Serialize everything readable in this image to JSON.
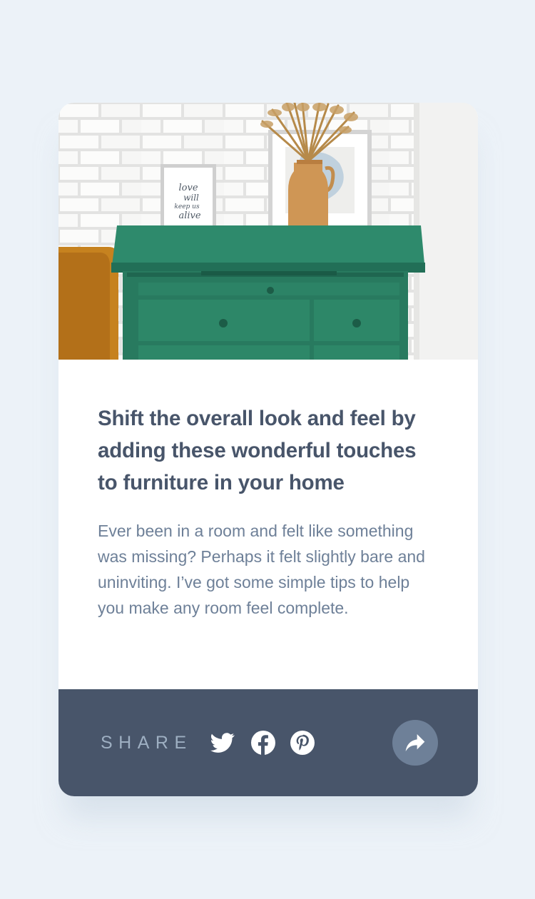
{
  "article": {
    "title": "Shift the overall look and feel by adding these wonderful touches to furniture in your home",
    "description": "Ever been in a room and felt like something was missing? Perhaps it felt slightly bare and uninviting. I’ve got some simple tips to help you make any room feel complete."
  },
  "hero": {
    "image": "drawers-photo",
    "frame_text": [
      "love",
      "will",
      "keep us",
      "alive"
    ]
  },
  "share": {
    "label": "SHARE",
    "icons": [
      "twitter-icon",
      "facebook-icon",
      "pinterest-icon",
      "share-icon"
    ]
  },
  "colors": {
    "page_background": "#ecf2f8",
    "footer_background": "#48556a",
    "title": "#48556a",
    "body_text": "#6e8098",
    "share_label": "#9eafc2",
    "share_button": "#6e8098"
  }
}
